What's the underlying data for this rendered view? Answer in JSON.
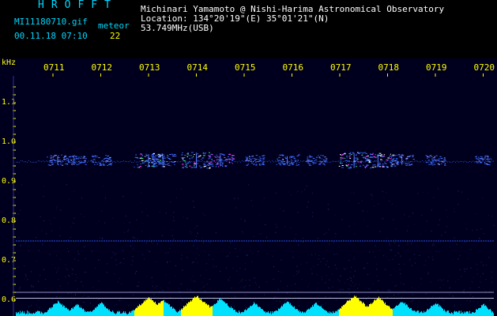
{
  "header": {
    "logo": "HROFFT",
    "filename": "MI11180710.gif",
    "date_time": "00.11.18 07:10",
    "meteor_label": "meteor",
    "meteor_count": "22",
    "observer": "Michinari Yamamoto @ Nishi-Harima Astronomical Observatory",
    "location": "Location: 134°20'19\"(E) 35°01'21\"(N)",
    "frequency": "53.749MHz(USB)"
  },
  "axis": {
    "unit": "kHz",
    "freq_ticks": [
      "1.1",
      "1.0",
      "0.9",
      "0.8",
      "0.7",
      "0.6"
    ],
    "time_ticks": [
      "0711",
      "0712",
      "0713",
      "0714",
      "0715",
      "0716",
      "0717",
      "0718",
      "0719",
      "0720"
    ]
  },
  "colors": {
    "background": "#00001e",
    "header_bg": "#000000",
    "text_white": "#ffffff",
    "text_cyan": "#00d8ff",
    "text_yellow": "#ffff00",
    "echo": "#3a6cff",
    "echo_bright": "#ffffff",
    "echo_magenta": "#ff40ff",
    "echo_green": "#40ff80",
    "noise_line": "#2040c0",
    "level_bar": "#00e0ff",
    "level_peak": "#ffff00"
  },
  "meteor_echoes": [
    {
      "time": "07:11.1",
      "strength": 0.6
    },
    {
      "time": "07:11.5",
      "strength": 0.4
    },
    {
      "time": "07:12.0",
      "strength": 0.5
    },
    {
      "time": "07:13.0",
      "strength": 0.9
    },
    {
      "time": "07:13.3",
      "strength": 0.7
    },
    {
      "time": "07:14.0",
      "strength": 1.0
    },
    {
      "time": "07:14.5",
      "strength": 0.8
    },
    {
      "time": "07:15.2",
      "strength": 0.5
    },
    {
      "time": "07:15.9",
      "strength": 0.6
    },
    {
      "time": "07:16.5",
      "strength": 0.5
    },
    {
      "time": "07:17.3",
      "strength": 1.0
    },
    {
      "time": "07:17.8",
      "strength": 0.9
    },
    {
      "time": "07:18.3",
      "strength": 0.6
    },
    {
      "time": "07:19.0",
      "strength": 0.5
    },
    {
      "time": "07:20.0",
      "strength": 0.4
    }
  ]
}
